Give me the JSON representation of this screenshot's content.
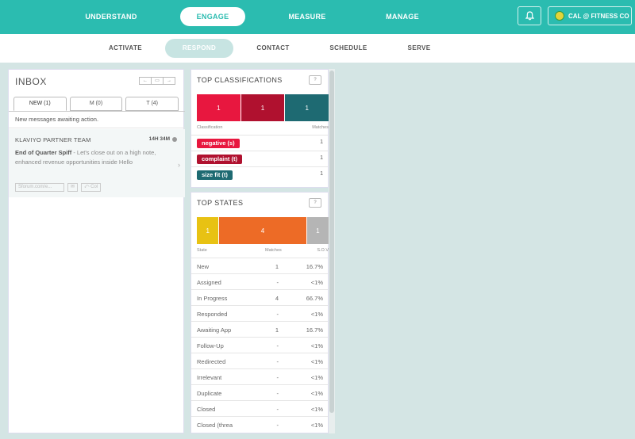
{
  "topnav": {
    "items": [
      "UNDERSTAND",
      "ENGAGE",
      "MEASURE",
      "MANAGE"
    ],
    "active": "ENGAGE",
    "bell_icon": "bell-icon",
    "account_label": "CAL @ FITNESS CO"
  },
  "subnav": {
    "items": [
      "ACTIVATE",
      "RESPOND",
      "CONTACT",
      "SCHEDULE",
      "SERVE"
    ],
    "active": "RESPOND"
  },
  "inbox": {
    "title": "INBOX",
    "controls": [
      "←",
      "▭",
      "→"
    ],
    "tabs": [
      "NEW (1)",
      "M (0)",
      "T (4)"
    ],
    "description": "New messages awaiting action.",
    "message": {
      "sender": "KLAVIYO PARTNER TEAM",
      "time": "14H 34M",
      "subject": "End of Quarter Spiff",
      "preview": " - Let's close out on a high note, enhanced revenue opportunities inside Hello",
      "actions": [
        "Sforum.com/e...",
        "✉",
        "⤺ Col"
      ]
    }
  },
  "classifications": {
    "title": "TOP CLASSIFICATIONS",
    "help": "?",
    "headers": {
      "left": "Classification",
      "right": "Matches"
    },
    "bar": [
      {
        "value": "1",
        "color": "#e8173f"
      },
      {
        "value": "1",
        "color": "#b0112f"
      },
      {
        "value": "1",
        "color": "#1e6a72"
      }
    ],
    "rows": [
      {
        "label": "negative (s)",
        "count": "1",
        "color": "#e8173f"
      },
      {
        "label": "complaint (t)",
        "count": "1",
        "color": "#b0112f"
      },
      {
        "label": "size fit (t)",
        "count": "1",
        "color": "#1e6a72"
      }
    ]
  },
  "states": {
    "title": "TOP STATES",
    "help": "?",
    "headers": {
      "state": "State",
      "matches": "Matches",
      "sov": "S.O.V"
    },
    "bar": [
      {
        "value": "1",
        "color": "#e8c213",
        "share": 16.7
      },
      {
        "value": "4",
        "color": "#ed6b26",
        "share": 66.7
      },
      {
        "value": "1",
        "color": "#b5b5b5",
        "share": 16.7
      }
    ],
    "rows": [
      {
        "state": "New",
        "matches": "1",
        "sov": "16.7%"
      },
      {
        "state": "Assigned",
        "matches": "-",
        "sov": "<1%"
      },
      {
        "state": "In Progress",
        "matches": "4",
        "sov": "66.7%"
      },
      {
        "state": "Responded",
        "matches": "-",
        "sov": "<1%"
      },
      {
        "state": "Awaiting App",
        "matches": "1",
        "sov": "16.7%"
      },
      {
        "state": "Follow-Up",
        "matches": "-",
        "sov": "<1%"
      },
      {
        "state": "Redirected",
        "matches": "-",
        "sov": "<1%"
      },
      {
        "state": "Irrelevant",
        "matches": "-",
        "sov": "<1%"
      },
      {
        "state": "Duplicate",
        "matches": "-",
        "sov": "<1%"
      },
      {
        "state": "Closed",
        "matches": "-",
        "sov": "<1%"
      },
      {
        "state": "Closed (threa",
        "matches": "-",
        "sov": "<1%"
      }
    ]
  }
}
